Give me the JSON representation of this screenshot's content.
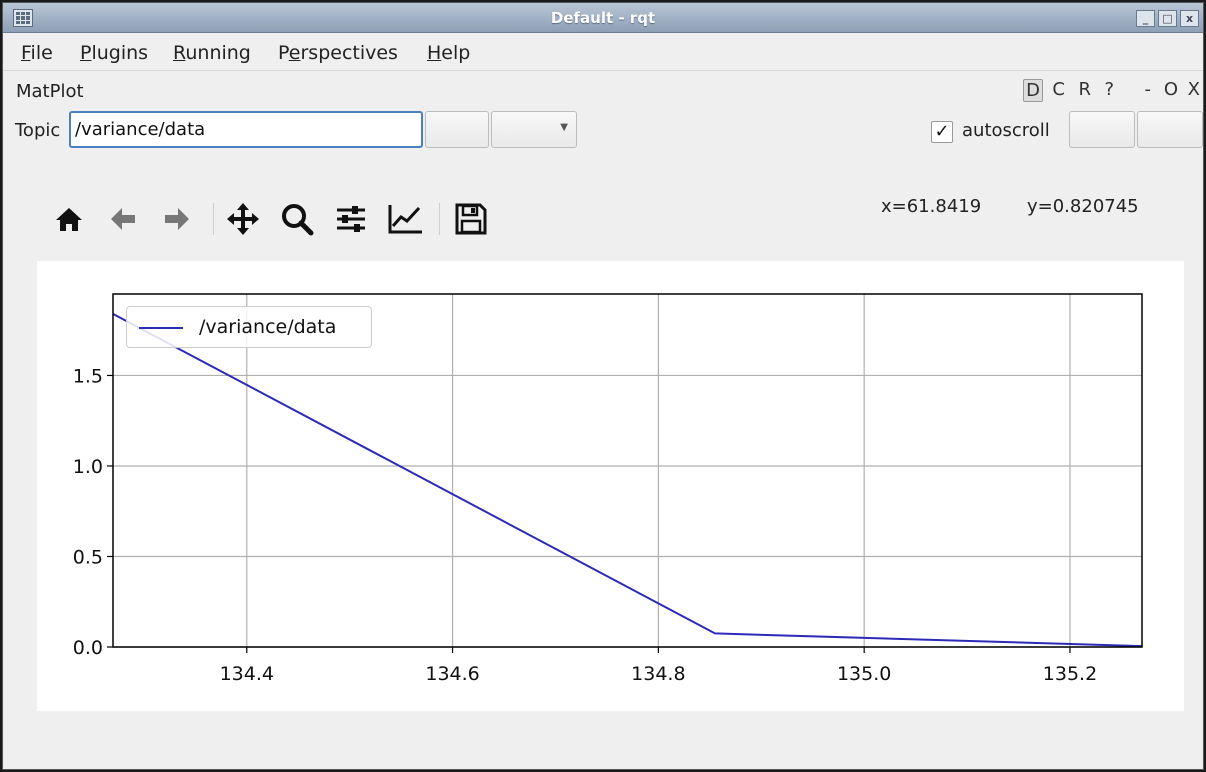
{
  "window": {
    "title": "Default - rqt",
    "buttons": [
      "_",
      "□",
      "x"
    ]
  },
  "menubar": {
    "items": [
      {
        "label": "File",
        "accel": "F",
        "rest": "ile"
      },
      {
        "label": "Plugins",
        "accel": "P",
        "rest": "lugins"
      },
      {
        "label": "Running",
        "accel": "R",
        "rest": "unning"
      },
      {
        "label": "Perspectives",
        "pre": "P",
        "accel": "e",
        "rest": "rspectives"
      },
      {
        "label": "Help",
        "accel": "H",
        "rest": "elp"
      }
    ]
  },
  "plugin": {
    "title": "MatPlot",
    "dock_buttons": [
      "D",
      "C",
      "R",
      "?",
      "-",
      "O",
      "X"
    ]
  },
  "topic": {
    "label": "Topic",
    "value": "/variance/data"
  },
  "autoscroll": {
    "label": "autoscroll",
    "checked": true,
    "check_glyph": "✓"
  },
  "toolbar": {
    "icons": [
      "home-icon",
      "back-arrow-icon",
      "forward-arrow-icon",
      "pan-icon",
      "zoom-icon",
      "subplots-config-icon",
      "axes-edit-icon",
      "save-icon"
    ]
  },
  "coordinates": {
    "x_text": "x=61.8419",
    "y_text": "y=0.820745"
  },
  "colors": {
    "series_line": "#2b2bb8",
    "grid": "#b0b0b0",
    "axes": "#000000"
  },
  "chart_data": {
    "type": "line",
    "title": "",
    "xlabel": "",
    "ylabel": "",
    "xlim": [
      134.27,
      135.27
    ],
    "ylim": [
      0.0,
      1.95
    ],
    "xticks": [
      134.4,
      134.6,
      134.8,
      135.0,
      135.2
    ],
    "xtick_labels": [
      "134.4",
      "134.6",
      "134.8",
      "135.0",
      "135.2"
    ],
    "yticks": [
      0.0,
      0.5,
      1.0,
      1.5
    ],
    "ytick_labels": [
      "0.0",
      "0.5",
      "1.0",
      "1.5"
    ],
    "grid": true,
    "legend_position": "top-left",
    "series": [
      {
        "name": "/variance/data",
        "x": [
          134.27,
          134.855,
          135.27
        ],
        "y": [
          1.84,
          0.075,
          0.005
        ]
      }
    ]
  }
}
